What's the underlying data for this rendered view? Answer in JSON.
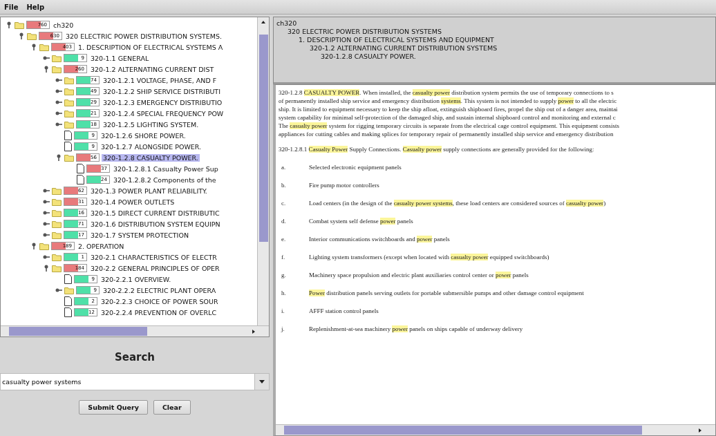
{
  "menu": [
    "File",
    "Help"
  ],
  "tree": [
    {
      "kind": "folder",
      "label": "ch320",
      "count": "760",
      "color": "#e87a7c",
      "expanded": true,
      "selected": false,
      "children": [
        {
          "kind": "folder",
          "label": "320 ELECTRIC POWER DISTRIBUTION SYSTEMS.",
          "count": "630",
          "color": "#e87a7c",
          "expanded": true,
          "selected": false,
          "children": [
            {
              "kind": "folder",
              "label": "1. DESCRIPTION OF ELECTRICAL SYSTEMS A",
              "count": "403",
              "color": "#e87a7c",
              "expanded": true,
              "selected": false,
              "children": [
                {
                  "kind": "folder",
                  "label": "320-1.1 GENERAL",
                  "count": "9",
                  "color": "#4fe0a8",
                  "expanded": false,
                  "selected": false
                },
                {
                  "kind": "folder",
                  "label": "320-1.2 ALTERNATING CURRENT DIST",
                  "count": "260",
                  "color": "#e87a7c",
                  "expanded": true,
                  "selected": false,
                  "children": [
                    {
                      "kind": "folder",
                      "label": "320-1.2.1 VOLTAGE, PHASE, AND F",
                      "count": "74",
                      "color": "#4fe0a8",
                      "expanded": false,
                      "selected": false
                    },
                    {
                      "kind": "folder",
                      "label": "320-1.2.2 SHIP SERVICE DISTRIBUTI",
                      "count": "49",
                      "color": "#4fe0a8",
                      "expanded": false,
                      "selected": false
                    },
                    {
                      "kind": "folder",
                      "label": "320-1.2.3 EMERGENCY DISTRIBUTIO",
                      "count": "29",
                      "color": "#4fe0a8",
                      "expanded": false,
                      "selected": false
                    },
                    {
                      "kind": "folder",
                      "label": "320-1.2.4 SPECIAL FREQUENCY POW",
                      "count": "21",
                      "color": "#4fe0a8",
                      "expanded": false,
                      "selected": false
                    },
                    {
                      "kind": "folder",
                      "label": "320-1.2.5 LIGHTING SYSTEM.",
                      "count": "18",
                      "color": "#4fe0a8",
                      "expanded": false,
                      "selected": false
                    },
                    {
                      "kind": "doc",
                      "label": "320-1.2.6 SHORE POWER.",
                      "count": "9",
                      "color": "#4fe0a8",
                      "selected": false
                    },
                    {
                      "kind": "doc",
                      "label": "320-1.2.7 ALONGSIDE POWER.",
                      "count": "9",
                      "color": "#4fe0a8",
                      "selected": false
                    },
                    {
                      "kind": "folder",
                      "label": "320-1.2.8 CASUALTY POWER.",
                      "count": "56",
                      "color": "#e87a7c",
                      "expanded": true,
                      "selected": true,
                      "children": [
                        {
                          "kind": "doc",
                          "label": "320-1.2.8.1 Casualty Power Sup",
                          "count": "37",
                          "color": "#e87a7c",
                          "selected": false
                        },
                        {
                          "kind": "doc",
                          "label": "320-1.2.8.2 Components of the",
                          "count": "24",
                          "color": "#4fe0a8",
                          "selected": false
                        }
                      ]
                    }
                  ]
                },
                {
                  "kind": "folder",
                  "label": "320-1.3 POWER PLANT RELIABILITY.",
                  "count": "62",
                  "color": "#e87a7c",
                  "expanded": false,
                  "selected": false
                },
                {
                  "kind": "folder",
                  "label": "320-1.4 POWER OUTLETS",
                  "count": "31",
                  "color": "#e87a7c",
                  "expanded": false,
                  "selected": false
                },
                {
                  "kind": "folder",
                  "label": "320-1.5 DIRECT CURRENT DISTRIBUTIC",
                  "count": "16",
                  "color": "#4fe0a8",
                  "expanded": false,
                  "selected": false
                },
                {
                  "kind": "folder",
                  "label": "320-1.6 DISTRIBUTION SYSTEM EQUIPN",
                  "count": "71",
                  "color": "#4fe0a8",
                  "expanded": false,
                  "selected": false
                },
                {
                  "kind": "folder",
                  "label": "320-1.7 SYSTEM PROTECTION",
                  "count": "17",
                  "color": "#4fe0a8",
                  "expanded": false,
                  "selected": false
                }
              ]
            },
            {
              "kind": "folder",
              "label": "2. OPERATION",
              "count": "189",
              "color": "#e87a7c",
              "expanded": true,
              "selected": false,
              "children": [
                {
                  "kind": "folder",
                  "label": "320-2.1 CHARACTERISTICS OF ELECTR",
                  "count": "1",
                  "color": "#4fe0a8",
                  "expanded": false,
                  "selected": false
                },
                {
                  "kind": "folder",
                  "label": "320-2.2 GENERAL PRINCIPLES OF OPER",
                  "count": "184",
                  "color": "#e87a7c",
                  "expanded": true,
                  "selected": false,
                  "children": [
                    {
                      "kind": "doc",
                      "label": "320-2.2.1 OVERVIEW.",
                      "count": "9",
                      "color": "#4fe0a8",
                      "selected": false
                    },
                    {
                      "kind": "folder",
                      "label": "320-2.2.2 ELECTRIC PLANT OPERA",
                      "count": "9",
                      "color": "#4fe0a8",
                      "expanded": false,
                      "selected": false
                    },
                    {
                      "kind": "doc",
                      "label": "320-2.2.3 CHOICE OF POWER SOUR",
                      "count": "2",
                      "color": "#4fe0a8",
                      "selected": false
                    },
                    {
                      "kind": "doc",
                      "label": "320-2.2.4 PREVENTION OF OVERLC",
                      "count": "12",
                      "color": "#4fe0a8",
                      "selected": false
                    }
                  ]
                }
              ]
            }
          ]
        }
      ]
    }
  ],
  "search": {
    "title": "Search",
    "value": "casualty power systems",
    "buttons": [
      "Submit Query",
      "Clear"
    ]
  },
  "breadcrumb": [
    {
      "label": "ch320",
      "children": [
        {
          "label": "320 ELECTRIC POWER DISTRIBUTION SYSTEMS",
          "children": [
            {
              "label": "1. DESCRIPTION OF ELECTRICAL SYSTEMS AND EQUIPMENT",
              "children": [
                {
                  "label": "320-1.2 ALTERNATING CURRENT DISTRIBUTION SYSTEMS",
                  "children": [
                    {
                      "label": "320-1.2.8 CASUALTY POWER."
                    }
                  ]
                }
              ]
            }
          ]
        }
      ]
    }
  ],
  "document": {
    "intro_lines": [
      [
        {
          "text": "320-1.2.8 ",
          "highlighted": false
        },
        {
          "text": "CASUALTY POWER",
          "highlighted": true
        },
        {
          "text": ". When installed, the ",
          "highlighted": false
        },
        {
          "text": "casualty power",
          "highlighted": true
        },
        {
          "text": " distribution system permits the use of temporary connections to s",
          "highlighted": false
        }
      ],
      [
        {
          "text": "of permanently installed ship service and emergency distribution ",
          "highlighted": false
        },
        {
          "text": "systems",
          "highlighted": true
        },
        {
          "text": ". This system is not intended to supply ",
          "highlighted": false
        },
        {
          "text": "power",
          "highlighted": true
        },
        {
          "text": " to all the electric",
          "highlighted": false
        }
      ],
      [
        {
          "text": "ship. It is limited to equipment necessary to keep the ship afloat, extinguish shipboard fires, propel the ship out of a danger area, maintai",
          "highlighted": false
        }
      ],
      [
        {
          "text": "system capability for minimal self-protection of the damaged ship, and sustain internal shipboard control and monitoring and external c",
          "highlighted": false
        }
      ],
      [
        {
          "text": "The ",
          "highlighted": false
        },
        {
          "text": "casualty power",
          "highlighted": true
        },
        {
          "text": " system for rigging temporary circuits is separate from the electrical cage control equipment. This equipment consists",
          "highlighted": false
        }
      ],
      [
        {
          "text": "appliances for cutting cables and making splices for temporary repair of permanently installed ship service and emergency distribution",
          "highlighted": false
        }
      ]
    ],
    "heading": [
      {
        "text": "320-1.2.8.1 ",
        "highlighted": false
      },
      {
        "text": "Casualty Power",
        "highlighted": true
      },
      {
        "text": " Supply Connections. ",
        "highlighted": false
      },
      {
        "text": "Casualty power",
        "highlighted": true
      },
      {
        "text": " supply connections are generally provided for the following:",
        "highlighted": false
      }
    ],
    "items": [
      {
        "marker": "a.",
        "segments": [
          {
            "text": "Selected electronic equipment panels",
            "highlighted": false
          }
        ]
      },
      {
        "marker": "b.",
        "segments": [
          {
            "text": "Fire pump motor controllers",
            "highlighted": false
          }
        ]
      },
      {
        "marker": "c.",
        "segments": [
          {
            "text": "Load centers (in the design of the ",
            "highlighted": false
          },
          {
            "text": "casualty power systems",
            "highlighted": true
          },
          {
            "text": ", these load centers are considered sources of ",
            "highlighted": false
          },
          {
            "text": "casualty power",
            "highlighted": true
          },
          {
            "text": ")",
            "highlighted": false
          }
        ]
      },
      {
        "marker": "d.",
        "segments": [
          {
            "text": "Combat system self defense ",
            "highlighted": false
          },
          {
            "text": "power",
            "highlighted": true
          },
          {
            "text": " panels",
            "highlighted": false
          }
        ]
      },
      {
        "marker": "e.",
        "segments": [
          {
            "text": "Interior communications switchboards and ",
            "highlighted": false
          },
          {
            "text": "power",
            "highlighted": true
          },
          {
            "text": " panels",
            "highlighted": false
          }
        ]
      },
      {
        "marker": "f.",
        "segments": [
          {
            "text": "Lighting system transformers (except when located with ",
            "highlighted": false
          },
          {
            "text": "casualty power",
            "highlighted": true
          },
          {
            "text": " equipped switchboards)",
            "highlighted": false
          }
        ]
      },
      {
        "marker": "g.",
        "segments": [
          {
            "text": "Machinery space propulsion and electric plant auxiliaries control center or ",
            "highlighted": false
          },
          {
            "text": "power",
            "highlighted": true
          },
          {
            "text": " panels",
            "highlighted": false
          }
        ]
      },
      {
        "marker": "h.",
        "segments": [
          {
            "text": "Power",
            "highlighted": true
          },
          {
            "text": " distribution panels serving outlets for portable submersible pumps and other damage control equipment",
            "highlighted": false
          }
        ]
      },
      {
        "marker": "i.",
        "segments": [
          {
            "text": "AFFF station control panels",
            "highlighted": false
          }
        ]
      },
      {
        "marker": "j.",
        "segments": [
          {
            "text": "Replenishment-at-sea machinery ",
            "highlighted": false
          },
          {
            "text": "power",
            "highlighted": true
          },
          {
            "text": " panels on ships capable of underway delivery",
            "highlighted": false
          }
        ]
      }
    ]
  }
}
